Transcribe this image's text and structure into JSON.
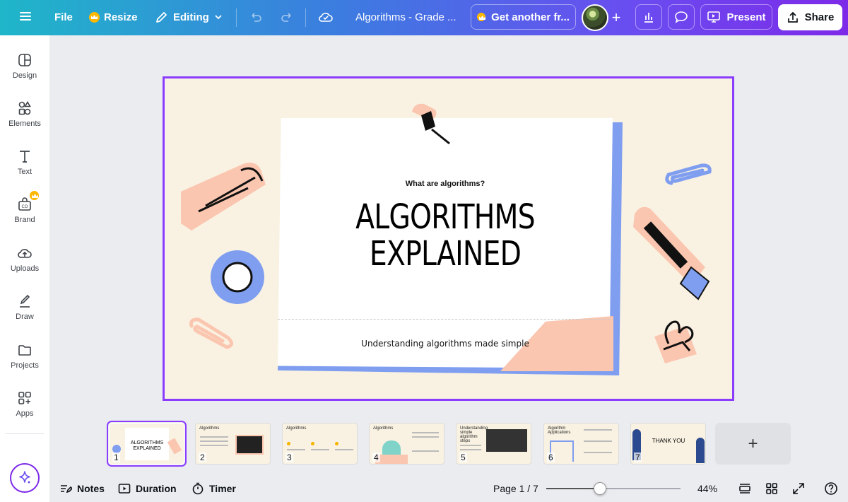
{
  "topbar": {
    "file_label": "File",
    "resize_label": "Resize",
    "editing_label": "Editing",
    "doc_title": "Algorithms  - Grade ...",
    "upgrade_label": "Get another fr...",
    "present_label": "Present",
    "share_label": "Share"
  },
  "sidebar": {
    "items": [
      {
        "label": "Design",
        "icon": "design-icon"
      },
      {
        "label": "Elements",
        "icon": "elements-icon"
      },
      {
        "label": "Text",
        "icon": "text-icon"
      },
      {
        "label": "Brand",
        "icon": "brand-icon"
      },
      {
        "label": "Uploads",
        "icon": "uploads-icon"
      },
      {
        "label": "Draw",
        "icon": "draw-icon"
      },
      {
        "label": "Projects",
        "icon": "projects-icon"
      },
      {
        "label": "Apps",
        "icon": "apps-icon"
      }
    ]
  },
  "slide": {
    "question": "What are ",
    "question_bold": "algorithms?",
    "title_line1": "ALGORITHMS",
    "title_line2": "EXPLAINED",
    "subtitle": "Understanding algorithms made simple"
  },
  "filmstrip": {
    "thumbs": [
      {
        "num": "1",
        "title": ""
      },
      {
        "num": "2",
        "title": "Algorithms"
      },
      {
        "num": "3",
        "title": "Algorithms"
      },
      {
        "num": "4",
        "title": "Algorithms"
      },
      {
        "num": "5",
        "title": "Understanding simple algorithm steps"
      },
      {
        "num": "6",
        "title": "Algorithm Applications"
      },
      {
        "num": "7",
        "title": "THANK YOU"
      }
    ],
    "add_label": "+"
  },
  "bottombar": {
    "notes_label": "Notes",
    "duration_label": "Duration",
    "timer_label": "Timer",
    "page_indicator": "Page 1 / 7",
    "zoom_level": "44%",
    "zoom_fraction": 0.4
  },
  "colors": {
    "accent": "#8b3dff",
    "slide_bg": "#f9f2e2",
    "peach": "#fbc6b0",
    "blue": "#7f9ef0"
  }
}
